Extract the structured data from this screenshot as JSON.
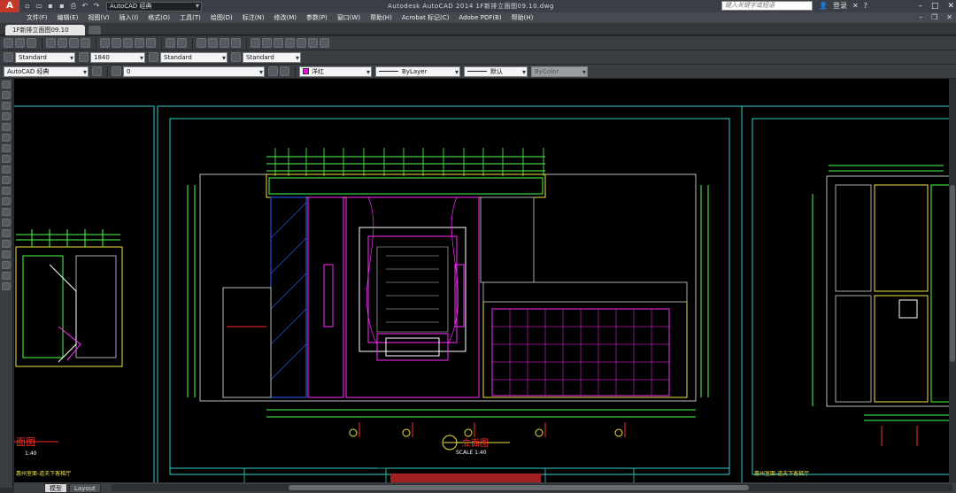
{
  "titlebar": {
    "app_logo": "A",
    "workspace": "AutoCAD 经典",
    "title": "Autodesk AutoCAD 2014    1F新排立面图09.10.dwg",
    "search_placeholder": "键入关键字或短语",
    "signin": "登录",
    "help": "?"
  },
  "menu": [
    "文件(F)",
    "编辑(E)",
    "视图(V)",
    "插入(I)",
    "格式(O)",
    "工具(T)",
    "绘图(D)",
    "标注(N)",
    "修改(M)",
    "参数(P)",
    "窗口(W)",
    "帮助(H)",
    "Acrobat 标记(C)",
    "Adobe PDF(B)",
    "帮助(H)"
  ],
  "document_tab": "1F新排立面图09.10",
  "styles": {
    "text_style": "Standard",
    "dim_style": "1840",
    "table_style": "Standard",
    "mleader_style": "Standard"
  },
  "workspace_combo": "AutoCAD 经典",
  "layer_combo": "0",
  "color_combo": "洋红",
  "linetype_combo": "ByLayer",
  "lineweight_combo": "默认",
  "plotstyle_combo": "ByColor",
  "drawing": {
    "center_title": "立面图",
    "center_scale": "SCALE 1:40",
    "left_title": "面图",
    "left_scale": "1:40",
    "left_footer": "惠州室面-道夫下客梯厅",
    "right_footer": "惠州室面-道夫下客梯厅"
  },
  "layout_tabs": [
    "模型",
    "Layout"
  ],
  "colors": {
    "sheet_border": "#2fd1c8",
    "dim_green": "#4cff4c",
    "magenta": "#ff2bff",
    "yellow": "#f0e442",
    "hatch_blue": "#2f5dff",
    "red": "#ff2a2a"
  }
}
